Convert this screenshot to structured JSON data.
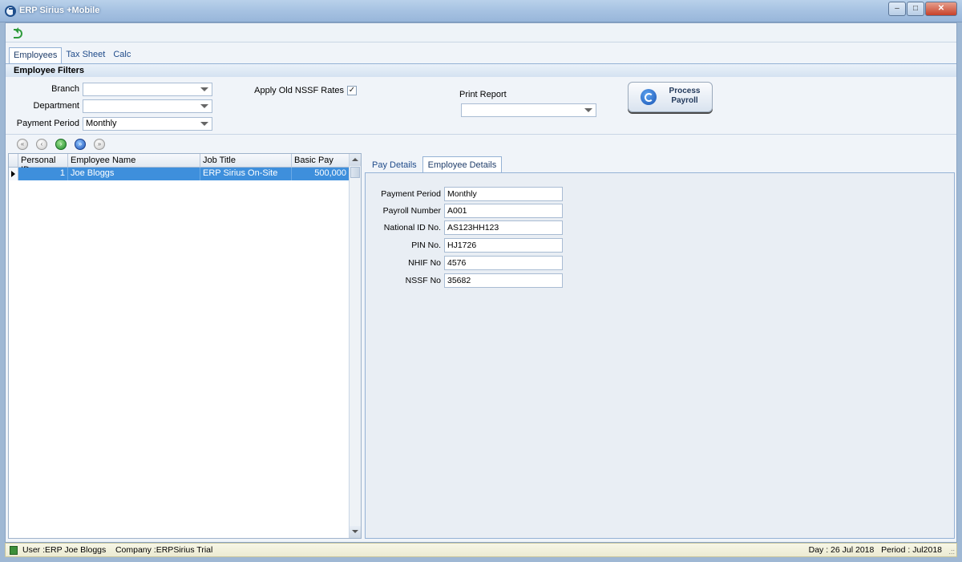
{
  "window": {
    "title": "ERP Sirius +Mobile",
    "minimize_glyph": "–",
    "maximize_glyph": "□",
    "close_glyph": "✕"
  },
  "main_tabs": [
    {
      "label": "Employees"
    },
    {
      "label": "Tax Sheet"
    },
    {
      "label": "Calc"
    }
  ],
  "filters": {
    "header": "Employee Filters",
    "branch_label": "Branch",
    "branch_value": "",
    "department_label": "Department",
    "department_value": "",
    "payment_period_label": "Payment Period",
    "payment_period_value": "Monthly",
    "apply_old_nssf_label": "Apply Old NSSF Rates",
    "apply_old_nssf_checked": "✓",
    "print_report_label": "Print Report",
    "print_report_value": ""
  },
  "process_button": {
    "line1": "Process",
    "line2": "Payroll"
  },
  "navigator": {
    "first_glyph": "«",
    "prev_glyph": "‹",
    "next_glyph": "›",
    "last_glyph": "»",
    "end_glyph": "»"
  },
  "grid": {
    "columns": [
      "Personal ID",
      "Employee Name",
      "Job Title",
      "Basic Pay"
    ],
    "rows": [
      {
        "personal_id": "1",
        "employee_name": "Joe Bloggs",
        "job_title": "ERP Sirius On-Site",
        "basic_pay": "500,000"
      }
    ]
  },
  "detail_tabs": [
    {
      "label": "Pay Details"
    },
    {
      "label": "Employee Details"
    }
  ],
  "employee_details": {
    "payment_period_label": "Payment Period",
    "payment_period": "Monthly",
    "payroll_number_label": "Payroll Number",
    "payroll_number": "A001",
    "national_id_label": "National ID No.",
    "national_id": "AS123HH123",
    "pin_label": "PIN No.",
    "pin": "HJ1726",
    "nhif_label": "NHIF No",
    "nhif": "4576",
    "nssf_label": "NSSF No",
    "nssf": "35682"
  },
  "status": {
    "user": "User :ERP Joe Bloggs",
    "company": "Company :ERPSirius Trial",
    "day": "Day : 26 Jul 2018",
    "period": "Period : Jul2018",
    "grip": ".::"
  },
  "colors": {
    "selection": "#3e8fdc",
    "tab_text": "#1f4b8a",
    "statusbar": "#f7f6e6"
  }
}
